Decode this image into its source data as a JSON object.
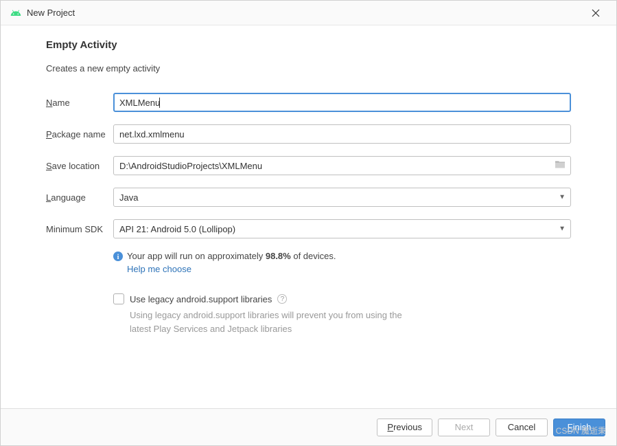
{
  "titlebar": {
    "title": "New Project"
  },
  "header": {
    "title": "Empty Activity",
    "desc": "Creates a new empty activity"
  },
  "fields": {
    "name": {
      "label_pre": "",
      "label_mn": "N",
      "label_post": "ame",
      "value": "XMLMenu"
    },
    "package": {
      "label_pre": "",
      "label_mn": "P",
      "label_post": "ackage name",
      "value": "net.lxd.xmlmenu"
    },
    "save": {
      "label_pre": "",
      "label_mn": "S",
      "label_post": "ave location",
      "value": "D:\\AndroidStudioProjects\\XMLMenu"
    },
    "language": {
      "label_pre": "",
      "label_mn": "L",
      "label_post": "anguage",
      "value": "Java"
    },
    "minsdk": {
      "label": "Minimum SDK",
      "value": "API 21: Android 5.0 (Lollipop)"
    }
  },
  "info": {
    "text_pre": "Your app will run on approximately ",
    "text_pct": "98.8%",
    "text_post": " of devices.",
    "help_link": "Help me choose"
  },
  "legacy": {
    "label": "Use legacy android.support libraries",
    "desc": "Using legacy android.support libraries will prevent you from using the latest Play Services and Jetpack libraries"
  },
  "footer": {
    "previous": "Previous",
    "previous_mn": "P",
    "next": "Next",
    "next_mn": "N",
    "cancel": "Cancel",
    "finish": "Finish",
    "finish_mn": "F"
  },
  "watermark": "CSDN 魔逝秉"
}
